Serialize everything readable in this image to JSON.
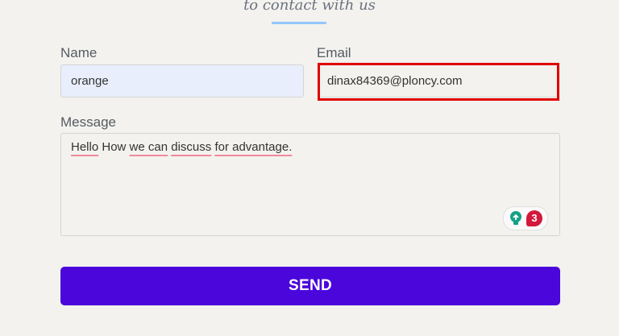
{
  "header": {
    "subtitle": "to contact with us"
  },
  "form": {
    "name_label": "Name",
    "name_value": "orange",
    "email_label": "Email",
    "email_value": "dinax84369@ploncy.com",
    "message_label": "Message",
    "message_words": [
      "Hello",
      "How",
      "we",
      "can",
      "discuss",
      "for",
      "advantage."
    ],
    "message_underlined": [
      "Hello",
      "we can",
      "discuss",
      "for advantage."
    ],
    "grammar_badge_icon": "lightbulb-icon",
    "grammar_issue_count": "3",
    "send_label": "SEND"
  },
  "colors": {
    "background": "#f3f2ee",
    "name_field_bg": "#e8eefc",
    "highlight": "#e00000",
    "send_button": "#4b06db",
    "accent_underline": "#93c5fd",
    "badge_count": "#d2193c",
    "bulb": "#16a085"
  }
}
